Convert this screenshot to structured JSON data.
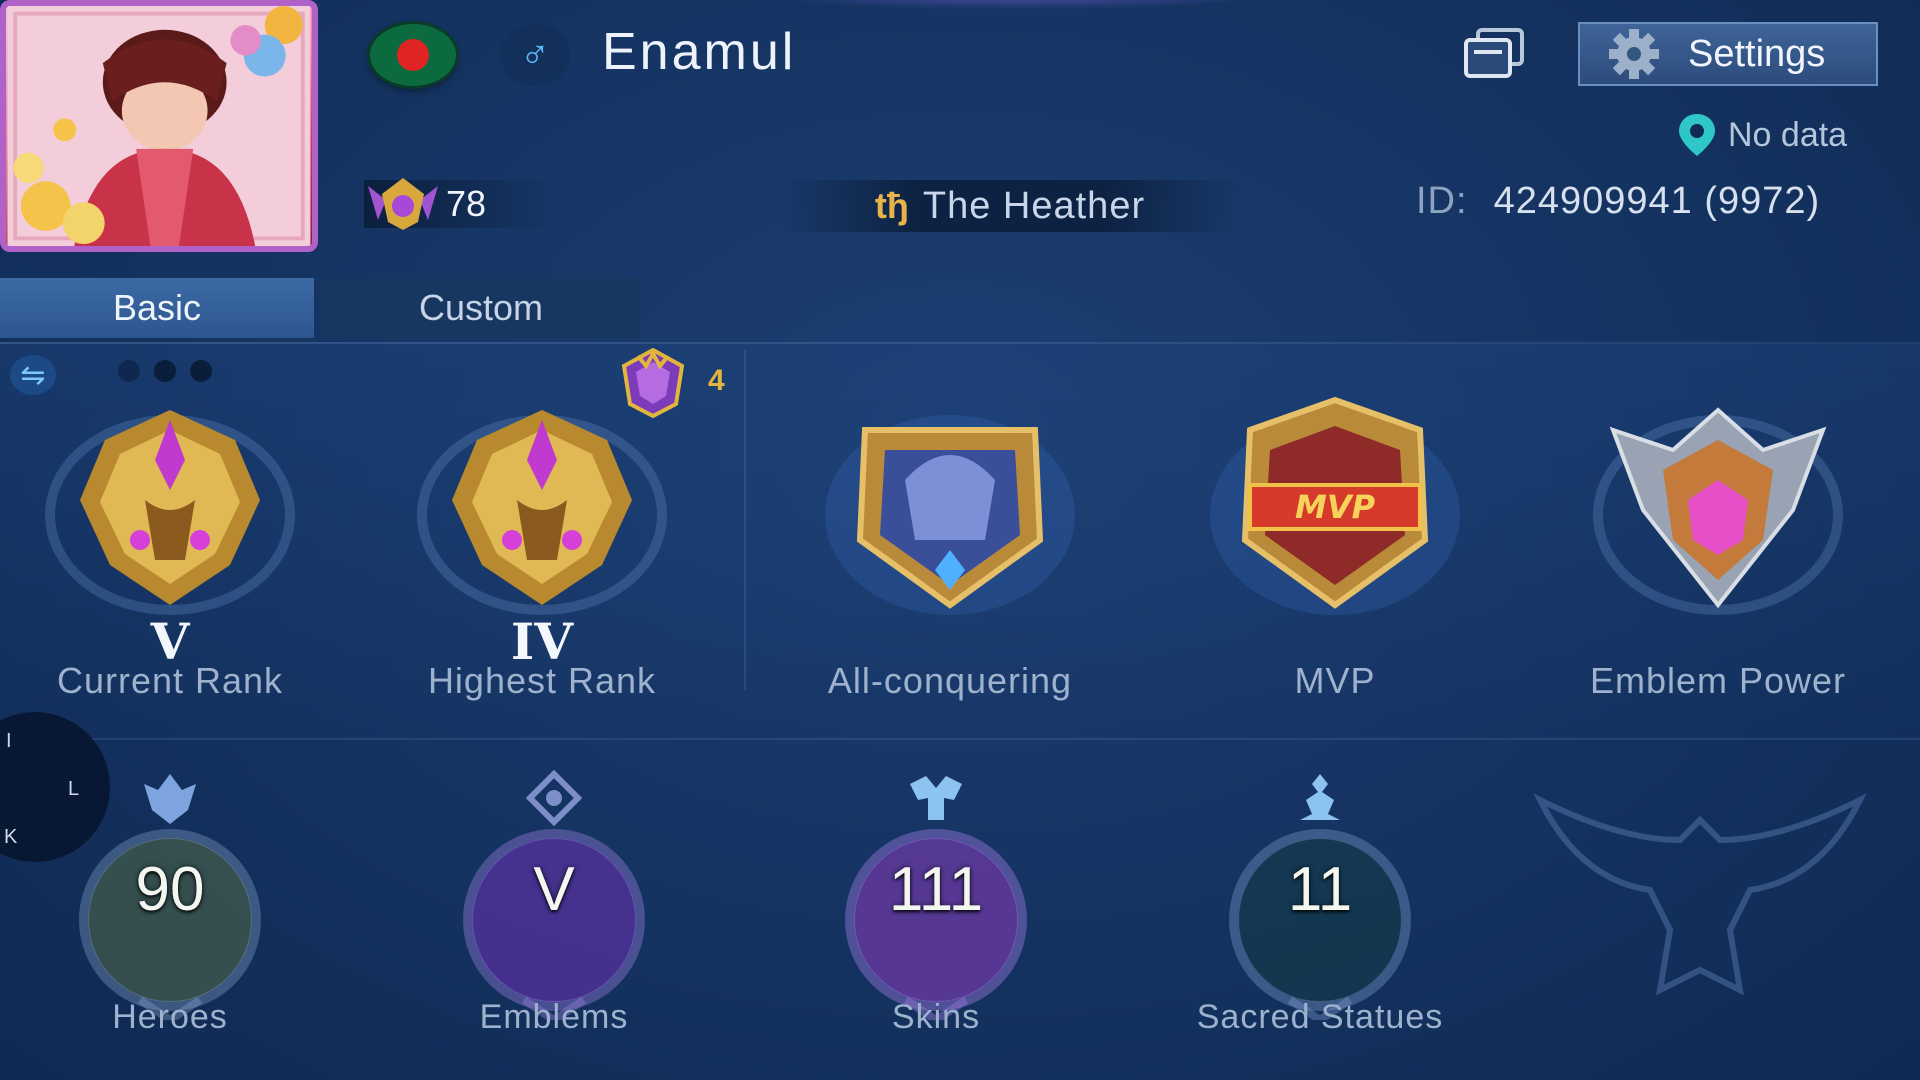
{
  "profile": {
    "name": "Enamul",
    "gender_symbol": "♂",
    "level": "78",
    "squad_symbol": "tђ",
    "squad_name": "The Heather",
    "id_label": "ID:",
    "id_value": "424909941 (9972)",
    "location": "No data"
  },
  "header": {
    "settings_label": "Settings"
  },
  "tabs": [
    {
      "label": "Basic",
      "active": true
    },
    {
      "label": "Custom",
      "active": false
    }
  ],
  "carousel": {
    "page_count": 3,
    "current_page": 2
  },
  "season_badge_count": "4",
  "achievements": [
    {
      "numeral": "V",
      "caption": "Current Rank"
    },
    {
      "numeral": "IV",
      "caption": "Highest Rank"
    },
    {
      "numeral": "",
      "caption": "All-conquering"
    },
    {
      "numeral": "",
      "caption": "MVP",
      "badge_text": "MVP"
    },
    {
      "numeral": "",
      "caption": "Emblem Power"
    }
  ],
  "stats": [
    {
      "value": "90",
      "caption": "Heroes"
    },
    {
      "value": "V",
      "caption": "Emblems"
    },
    {
      "value": "111",
      "caption": "Skins"
    },
    {
      "value": "11",
      "caption": "Sacred Statues"
    }
  ],
  "side_menu": {
    "letters": [
      "I",
      "L",
      "K"
    ]
  },
  "colors": {
    "background": "#163564",
    "accent_gold": "#e2b63c",
    "tab_active": "#3c6aa4",
    "tab_inactive": "#173660",
    "caption": "#9fb2cd"
  },
  "icons": {
    "flag": "bangladesh-flag-icon",
    "gender": "male-icon",
    "messages": "message-icon",
    "settings": "gear-icon",
    "location": "location-pin-icon",
    "level": "level-badge-icon",
    "swap": "swap-icon"
  }
}
